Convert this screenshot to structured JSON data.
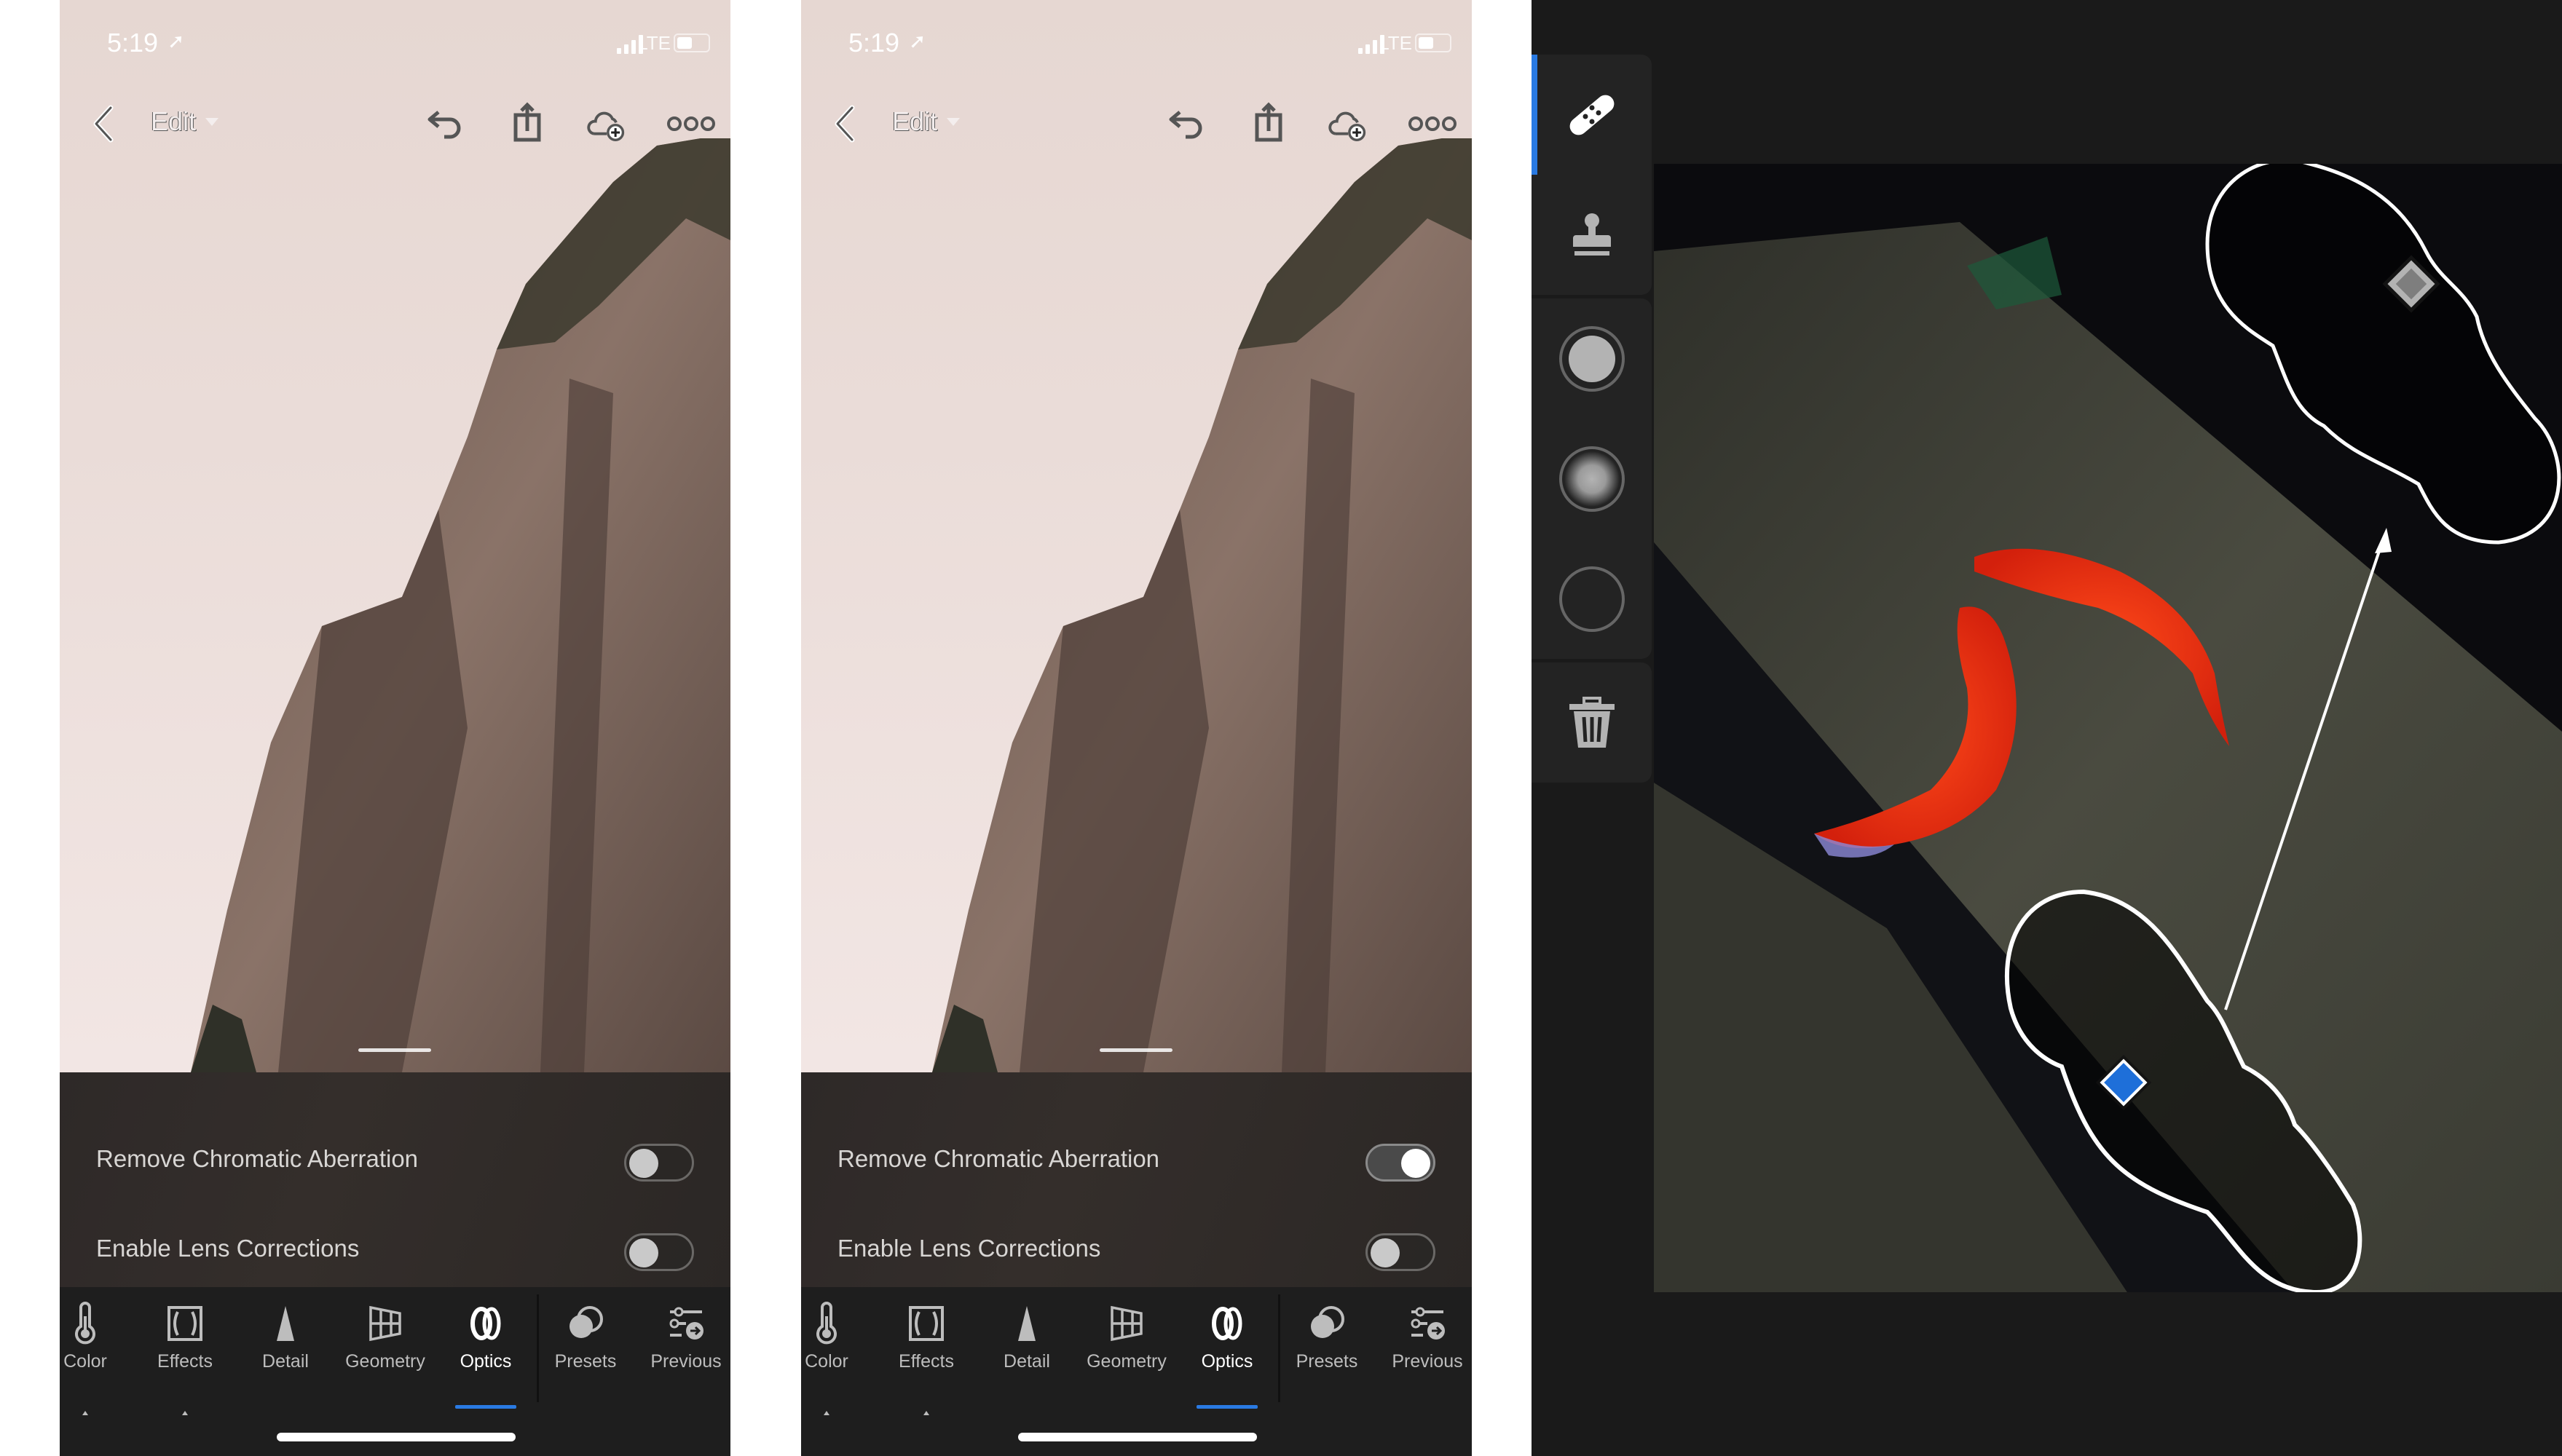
{
  "phones": [
    {
      "status": {
        "time": "5:19",
        "network": "LTE",
        "location_icon": "location-arrow-icon"
      },
      "nav": {
        "back_icon": "chevron-left-icon",
        "title": "Edit",
        "actions": [
          "undo-icon",
          "share-icon",
          "cloud-add-icon",
          "more-icon"
        ]
      },
      "optics": {
        "rows": [
          {
            "label": "Remove Chromatic Aberration",
            "enabled": false
          },
          {
            "label": "Enable Lens Corrections",
            "enabled": false
          }
        ]
      },
      "tabs": [
        {
          "label": "Color",
          "icon": "thermometer-icon",
          "active": false,
          "has_indicator": true
        },
        {
          "label": "Effects",
          "icon": "vignette-icon",
          "active": false,
          "has_indicator": true
        },
        {
          "label": "Detail",
          "icon": "triangle-icon",
          "active": false,
          "has_indicator": false
        },
        {
          "label": "Geometry",
          "icon": "grid-perspective-icon",
          "active": false,
          "has_indicator": false
        },
        {
          "label": "Optics",
          "icon": "lens-icon",
          "active": true,
          "has_indicator": false
        },
        {
          "label": "Presets",
          "icon": "presets-icon",
          "active": false,
          "has_indicator": false
        },
        {
          "label": "Previous",
          "icon": "previous-sliders-icon",
          "active": false,
          "has_indicator": false
        }
      ]
    },
    {
      "status": {
        "time": "5:19",
        "network": "LTE",
        "location_icon": "location-arrow-icon"
      },
      "nav": {
        "back_icon": "chevron-left-icon",
        "title": "Edit",
        "actions": [
          "undo-icon",
          "share-icon",
          "cloud-add-icon",
          "more-icon"
        ]
      },
      "optics": {
        "rows": [
          {
            "label": "Remove Chromatic Aberration",
            "enabled": true
          },
          {
            "label": "Enable Lens Corrections",
            "enabled": false
          }
        ]
      },
      "tabs": [
        {
          "label": "Color",
          "icon": "thermometer-icon",
          "active": false,
          "has_indicator": true
        },
        {
          "label": "Effects",
          "icon": "vignette-icon",
          "active": false,
          "has_indicator": true
        },
        {
          "label": "Detail",
          "icon": "triangle-icon",
          "active": false,
          "has_indicator": false
        },
        {
          "label": "Geometry",
          "icon": "grid-perspective-icon",
          "active": false,
          "has_indicator": false
        },
        {
          "label": "Optics",
          "icon": "lens-icon",
          "active": true,
          "has_indicator": false
        },
        {
          "label": "Presets",
          "icon": "presets-icon",
          "active": false,
          "has_indicator": false
        },
        {
          "label": "Previous",
          "icon": "previous-sliders-icon",
          "active": false,
          "has_indicator": false
        }
      ]
    }
  ],
  "healing_panel": {
    "tools": [
      {
        "name": "healing-brush",
        "icon": "bandage-icon",
        "selected": true
      },
      {
        "name": "clone-stamp",
        "icon": "stamp-icon",
        "selected": false
      },
      {
        "name": "brush-hard",
        "icon": "hard-brush-icon",
        "selected": false
      },
      {
        "name": "brush-soft",
        "icon": "soft-brush-icon",
        "selected": false
      },
      {
        "name": "brush-none",
        "icon": "brush-outline-icon",
        "selected": false
      },
      {
        "name": "delete",
        "icon": "trash-icon",
        "selected": false
      }
    ],
    "colors": {
      "accent": "#2a7ae2",
      "target_pin": "#1e6fd9",
      "source_pin": "#8a8a8a"
    }
  }
}
